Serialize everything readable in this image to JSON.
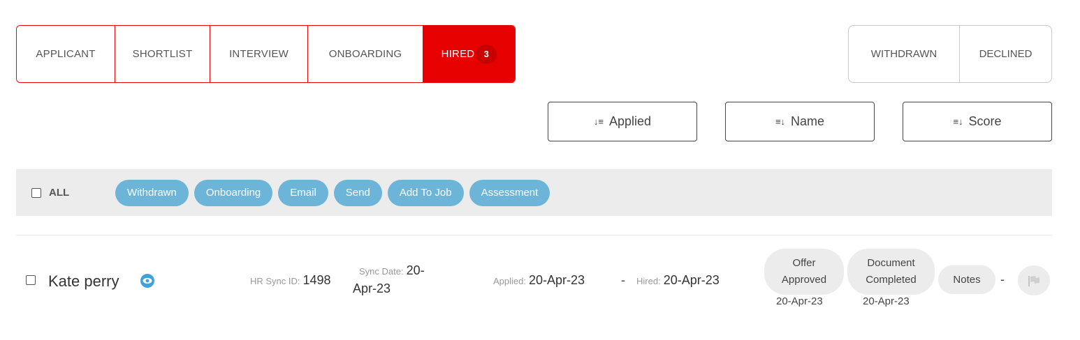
{
  "stages": {
    "tabs": [
      {
        "label": "APPLICANT"
      },
      {
        "label": "SHORTLIST"
      },
      {
        "label": "INTERVIEW"
      },
      {
        "label": "ONBOARDING"
      },
      {
        "label": "HIRED",
        "count": "3"
      }
    ],
    "side_tabs": [
      {
        "label": "WITHDRAWN"
      },
      {
        "label": "DECLINED"
      }
    ]
  },
  "sort": {
    "applied": "Applied",
    "name": "Name",
    "score": "Score"
  },
  "bulk": {
    "all_label": "ALL",
    "actions": [
      "Withdrawn",
      "Onboarding",
      "Email",
      "Send",
      "Add To Job",
      "Assessment"
    ]
  },
  "candidate": {
    "name": "Kate perry",
    "hr_sync_label": "HR Sync ID:",
    "hr_sync_id": "1498",
    "sync_date_label": "Sync Date:",
    "sync_date_part1": "20-",
    "sync_date_part2": "Apr-23",
    "applied_label": "Applied:",
    "applied_date": "20-Apr-23",
    "separator": "-",
    "hired_label": "Hired:",
    "hired_date": "20-Apr-23",
    "offer_line1": "Offer",
    "offer_line2": "Approved",
    "offer_date": "20-Apr-23",
    "doc_line1": "Document",
    "doc_line2": "Completed",
    "doc_date": "20-Apr-23",
    "notes_label": "Notes",
    "notes_dash": "-"
  },
  "colors": {
    "accent_red": "#e60000",
    "pill_blue": "#6cb5d8",
    "eye_blue": "#3fa2d9"
  }
}
